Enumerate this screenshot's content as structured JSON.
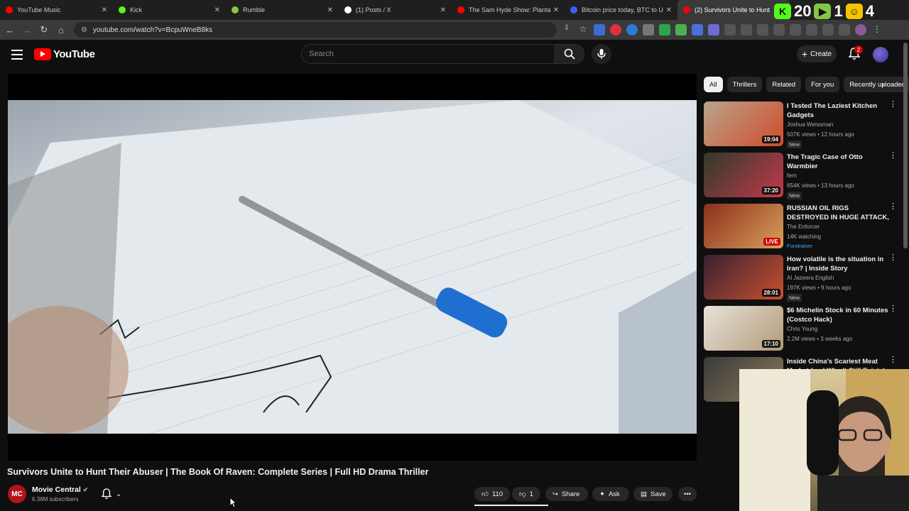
{
  "browser": {
    "tabs": [
      {
        "label": "YouTube Music",
        "color": "#ff0000"
      },
      {
        "label": "Kick",
        "color": "#53fc18"
      },
      {
        "label": "Rumble",
        "color": "#85c742"
      },
      {
        "label": "(1) Posts / X",
        "color": "#ffffff"
      },
      {
        "label": "The Sam Hyde Show: Plantation",
        "color": "#ff0000"
      },
      {
        "label": "Bitcoin price today, BTC to USD",
        "color": "#3861fb"
      },
      {
        "label": "(2) Survivors Unite to Hunt",
        "color": "#ff0000"
      }
    ],
    "url": "youtube.com/watch?v=BcpuWneB8ks",
    "hud": {
      "k1": "K",
      "n1": "20",
      "n2": "1",
      "n3": "4"
    }
  },
  "youtube": {
    "logo_text": "YouTube",
    "search_placeholder": "Search",
    "create_label": "Create",
    "notification_count": "2"
  },
  "video": {
    "title": "Survivors Unite to Hunt Their Abuser | The Book Of Raven: Complete Series | Full HD Drama Thriller",
    "channel_name": "Movie Central",
    "subscribers": "6.36M subscribers",
    "likes": "110",
    "dislikes": "1",
    "share_label": "Share",
    "ask_label": "Ask",
    "save_label": "Save"
  },
  "filters": [
    "All",
    "Thrillers",
    "Related",
    "For you",
    "Recently uploaded"
  ],
  "recommendations": [
    {
      "title": "I Tested The Laziest Kitchen Gadgets",
      "channel": "Joshua Weissman",
      "meta": "507K views • 12 hours ago",
      "tag": "New",
      "duration": "19:04",
      "thumb": [
        "#b9a48a",
        "#d04b2c"
      ]
    },
    {
      "title": "The Tragic Case of Otto Warmbier",
      "channel": "fern",
      "meta": "654K views • 13 hours ago",
      "tag": "New",
      "duration": "37:20",
      "thumb": [
        "#2f3a2a",
        "#c4394b"
      ]
    },
    {
      "title": "RUSSIAN OIL RIGS DESTROYED IN HUGE ATTACK, IRAN ...",
      "channel": "The Enforcer",
      "meta": "14K watching",
      "tag": "Fundraiser",
      "duration": "LIVE",
      "thumb": [
        "#8c2f1c",
        "#d9a05c"
      ]
    },
    {
      "title": "How volatile is the situation in Iran? | Inside Story",
      "channel": "Al Jazeera English",
      "meta": "197K views • 9 hours ago",
      "tag": "New",
      "duration": "28:01",
      "thumb": [
        "#3a2030",
        "#c85030"
      ]
    },
    {
      "title": "$6 Michelin Stock in 60 Minutes (Costco Hack)",
      "channel": "Chris Young",
      "meta": "2.2M views • 3 weeks ago",
      "tag": "",
      "duration": "17:10",
      "thumb": [
        "#e7e3da",
        "#b39a78"
      ]
    },
    {
      "title": "Inside China's Scariest Meat Market (and Why It Still Exists)",
      "channel": "",
      "meta": "",
      "tag": "",
      "duration": "",
      "thumb": [
        "#3a3a3a",
        "#8a7a5a"
      ]
    }
  ]
}
